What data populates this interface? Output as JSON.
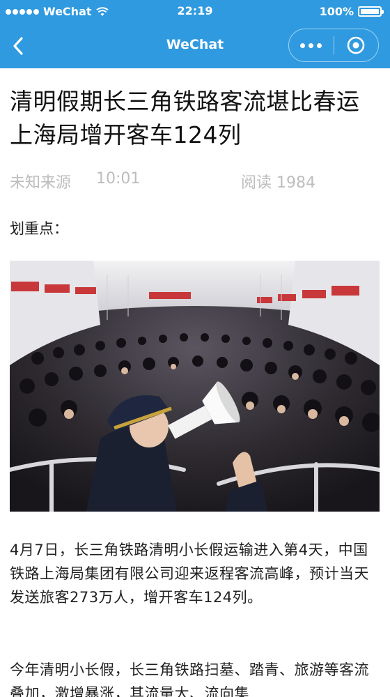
{
  "status_bar": {
    "carrier": "WeChat",
    "time": "22:19",
    "battery": "100%",
    "battery_level": 1.0
  },
  "nav": {
    "title": "WeChat",
    "back_icon": "chevron-left-icon",
    "more_icon": "more-dots-icon",
    "close_icon": "target-close-icon"
  },
  "colors": {
    "nav_background": "#2f9ae0",
    "meta_text": "#bdbdbd",
    "body_text": "#222222"
  },
  "article": {
    "title": "清明假期长三角铁路客流堪比春运 上海局增开客车124列",
    "source": "未知来源",
    "time": "10:01",
    "reads": "阅读 1984",
    "highlights_label": "划重点：",
    "image_alt": "crowded railway station hall with a staff member using a megaphone",
    "paragraphs": [
      "4月7日，长三角铁路清明小长假运输进入第4天，中国铁路上海局集团有限公司迎来返程客流高峰，预计当天发送旅客273万人，增开客车124列。",
      "今年清明小长假，长三角铁路扫墓、踏青、旅游等客流叠加，激增暴涨，其流量大、流向集"
    ]
  }
}
